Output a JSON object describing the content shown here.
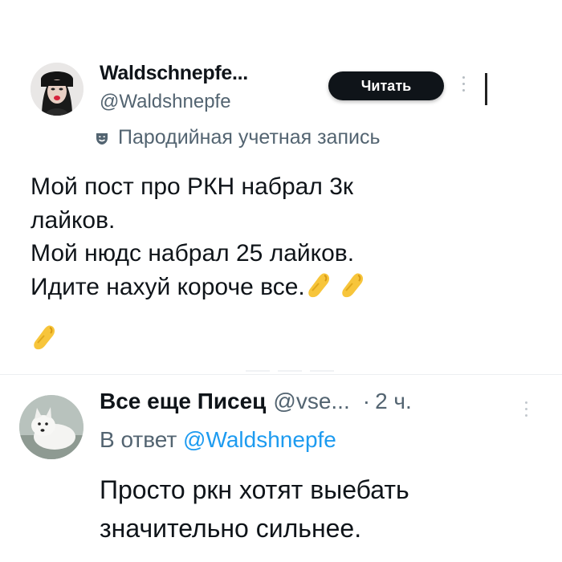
{
  "post": {
    "display_name": "Waldschnepfe...",
    "handle": "@Waldshnepfe",
    "follow_label": "Читать",
    "account_label": "Пародийная учетная запись",
    "text_lines": [
      "Мой пост про РКН набрал 3к",
      "лайков.",
      "Мой нюдс набрал 25 лайков.",
      "Идите нахуй короче все."
    ],
    "emoji_name": "pinched-fingers-emoji",
    "icons": {
      "more": "more-vertical-icon",
      "parody": "theater-masks-icon"
    }
  },
  "reply": {
    "display_name": "Все еще Писец",
    "handle": "@vse...",
    "separator": "·",
    "time": "2 ч.",
    "reply_prefix": "В ответ",
    "reply_mention": "@Waldshnepfe",
    "text_lines": [
      "Просто ркн хотят выебать",
      "значительно сильнее."
    ]
  },
  "colors": {
    "text": "#0f1419",
    "secondary": "#536471",
    "link": "#1d9bf0",
    "button": "#0f1419",
    "emoji": "#f7c53b"
  }
}
